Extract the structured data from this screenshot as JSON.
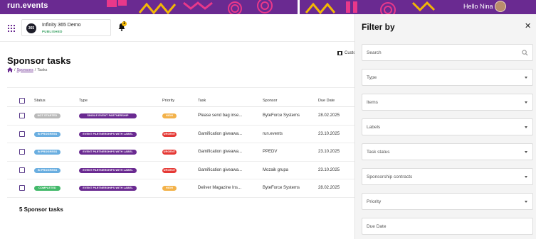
{
  "brand": {
    "logo_text": "run.events"
  },
  "user": {
    "greeting": "Hello Nina"
  },
  "event": {
    "name": "Infinity 365 Demo",
    "status": "PUBLISHED",
    "logo_text": "365"
  },
  "notifications": {
    "count": "1"
  },
  "page": {
    "title": "Sponsor tasks",
    "breadcrumb": [
      "/",
      "Sponsors",
      "/",
      "Tasks"
    ],
    "customize_label": "Custo"
  },
  "table": {
    "headers": {
      "status": "Status",
      "type": "Type",
      "priority": "Priority",
      "task": "Task",
      "sponsor": "Sponsor",
      "due_date": "Due Date"
    },
    "rows": [
      {
        "status": "NOT STARTED",
        "status_color": "#b9b9b9",
        "type": "SINGLE EVENT PARTNERSHIP",
        "priority": "HIGH",
        "priority_color": "#f3b24a",
        "task": "Please send bag inse...",
        "sponsor": "ByteForce Systems",
        "due_date": "28.02.2025"
      },
      {
        "status": "IN PROGRESS",
        "status_color": "#6aaee0",
        "type": "EVENT PARTNERSHIPS WITH LABEL",
        "priority": "URGENT",
        "priority_color": "#e53935",
        "task": "Gamification giveawa...",
        "sponsor": "run.events",
        "due_date": "23.10.2025"
      },
      {
        "status": "IN PROGRESS",
        "status_color": "#6aaee0",
        "type": "EVENT PARTNERSHIPS WITH LABEL",
        "priority": "URGENT",
        "priority_color": "#e53935",
        "task": "Gamification giveawa...",
        "sponsor": "PPEDV",
        "due_date": "23.10.2025"
      },
      {
        "status": "IN PROGRESS",
        "status_color": "#6aaee0",
        "type": "EVENT PARTNERSHIPS WITH LABEL",
        "priority": "URGENT",
        "priority_color": "#e53935",
        "task": "Gamification giveawa...",
        "sponsor": "Mozaik grupa",
        "due_date": "23.10.2025"
      },
      {
        "status": "COMPLETED",
        "status_color": "#43b96a",
        "type": "EVENT PARTNERSHIPS WITH LABEL",
        "priority": "HIGH",
        "priority_color": "#f3b24a",
        "task": "Deliver Magazine Ins...",
        "sponsor": "ByteForce Systems",
        "due_date": "28.02.2025"
      }
    ],
    "summary": "5 Sponsor tasks"
  },
  "filter": {
    "title": "Filter by",
    "search_placeholder": "Search",
    "fields": [
      "Type",
      "Items",
      "Labels",
      "Task status",
      "Sponsorship contracts",
      "Priority",
      "Due Date"
    ]
  },
  "colors": {
    "brand_purple": "#6a2a91",
    "accent_yellow": "#f2b705",
    "accent_pink": "#e8388a"
  },
  "icons": [
    "apps-grid-icon",
    "bell-icon",
    "home-icon",
    "columns-icon",
    "close-icon",
    "search-icon",
    "chevron-down-icon"
  ]
}
